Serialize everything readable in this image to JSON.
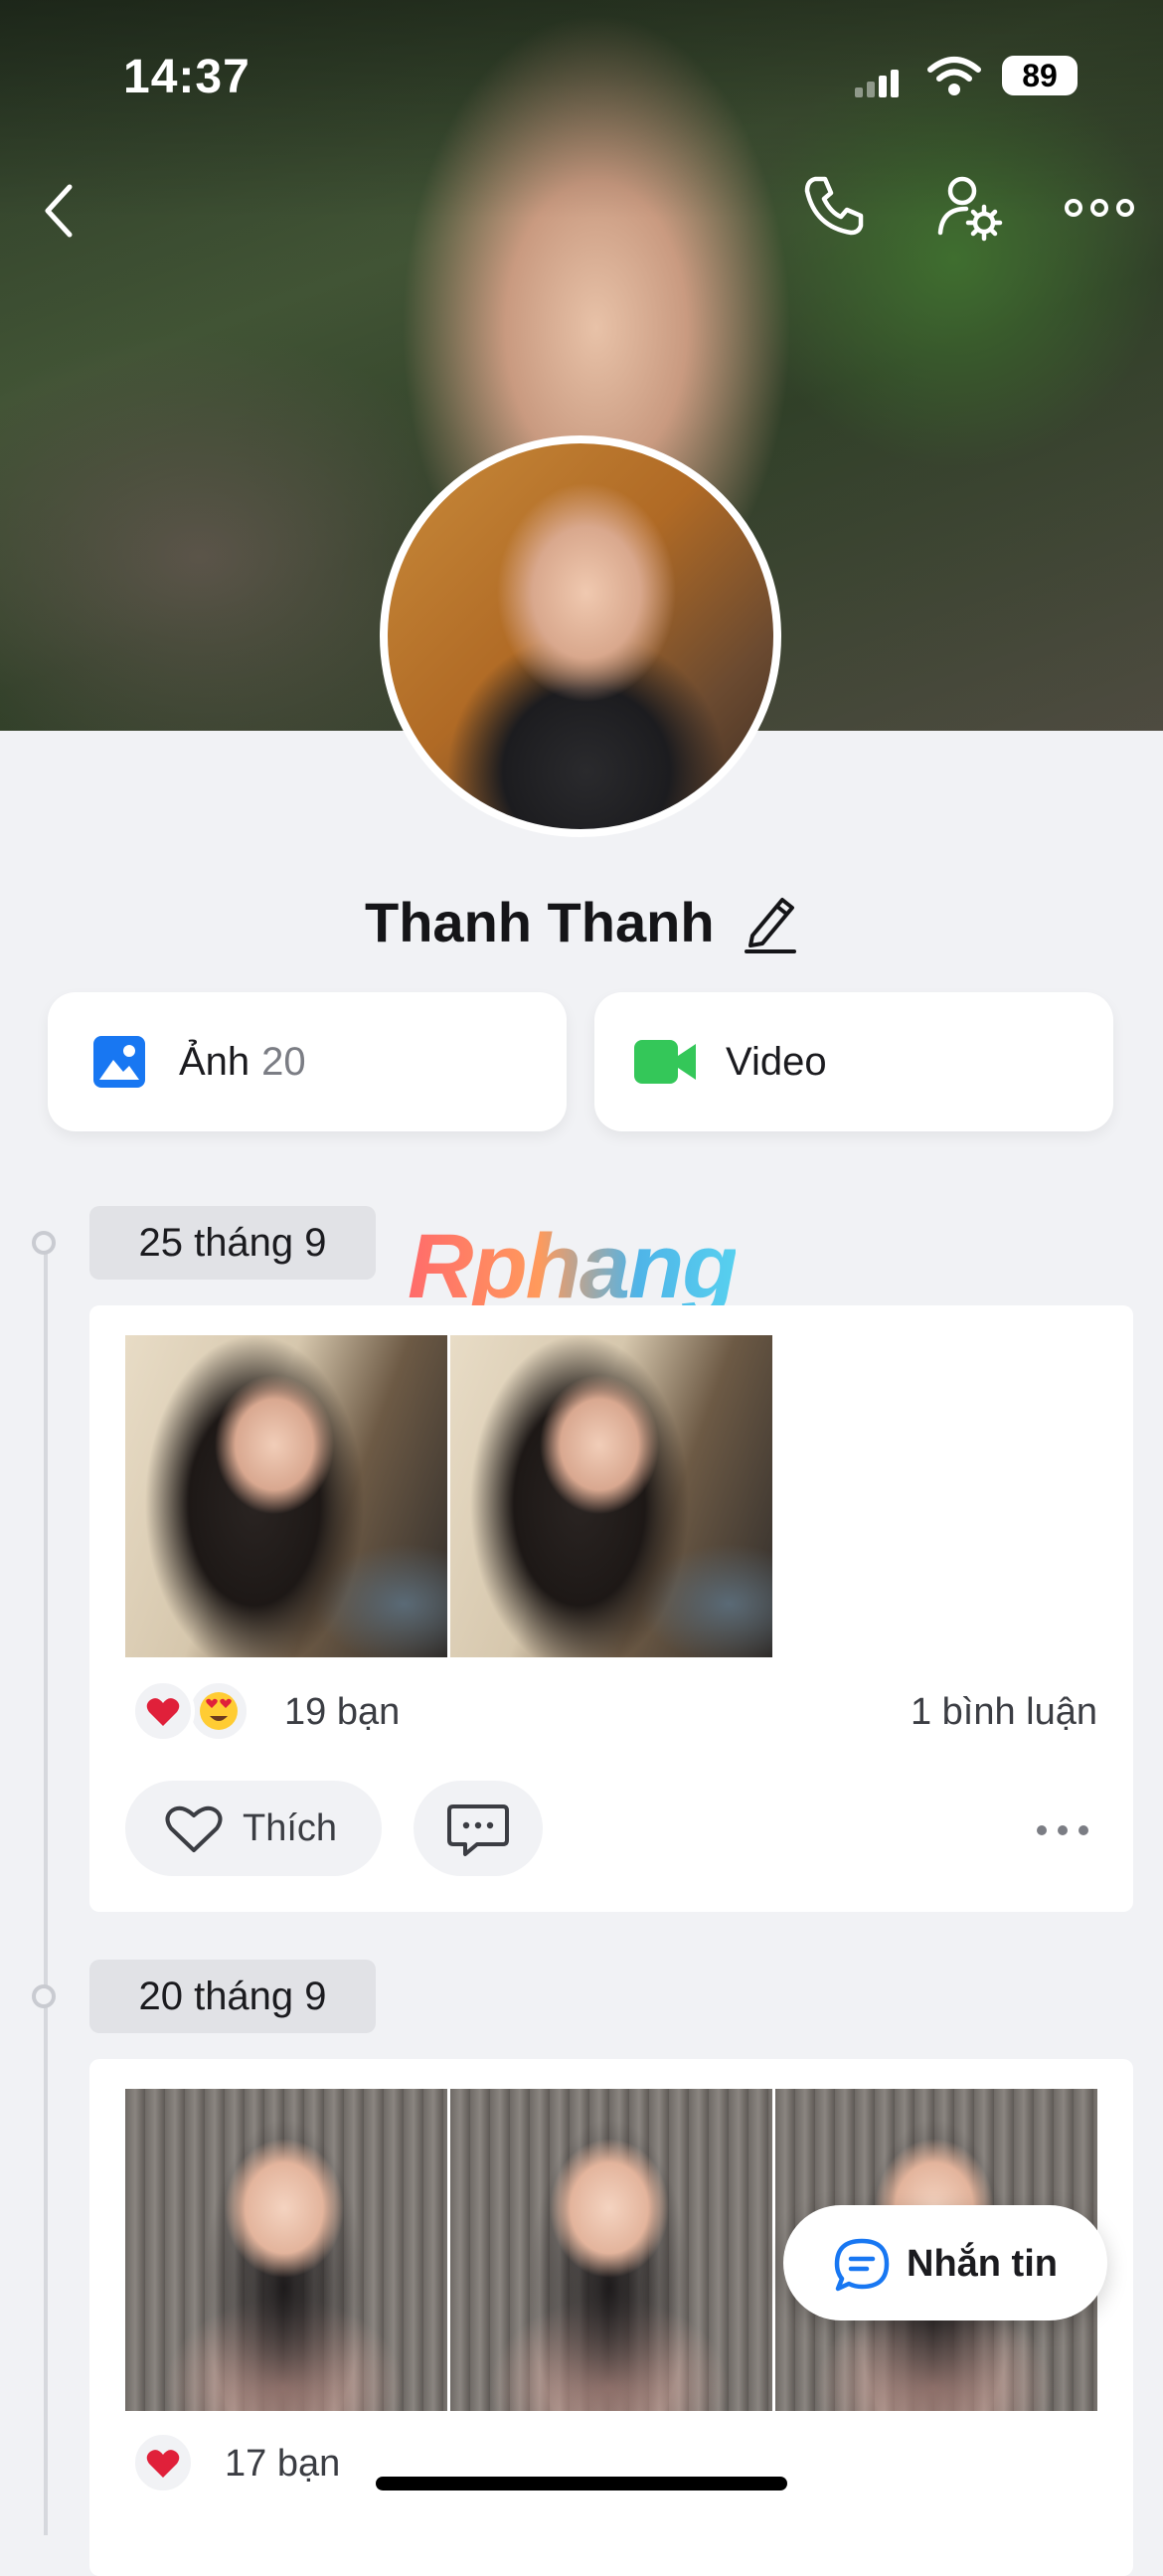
{
  "status_bar": {
    "time": "14:37",
    "battery": "89"
  },
  "profile": {
    "name": "Thanh Thanh"
  },
  "tabs": {
    "photos_label": "Ảnh",
    "photos_count": "20",
    "video_label": "Video"
  },
  "watermark": "Rphang",
  "posts": [
    {
      "date": "25 tháng 9",
      "reactions": [
        "heart",
        "heart-eyes"
      ],
      "reaction_count": "19 bạn",
      "comment_count": "1 bình luận",
      "like_label": "Thích"
    },
    {
      "date": "20 tháng 9",
      "reactions": [
        "heart"
      ],
      "reaction_count": "17 bạn"
    }
  ],
  "fab": {
    "label": "Nhắn tin"
  },
  "colors": {
    "accent_blue": "#1877f2",
    "video_green": "#34c759",
    "heart_red": "#e0203a"
  }
}
